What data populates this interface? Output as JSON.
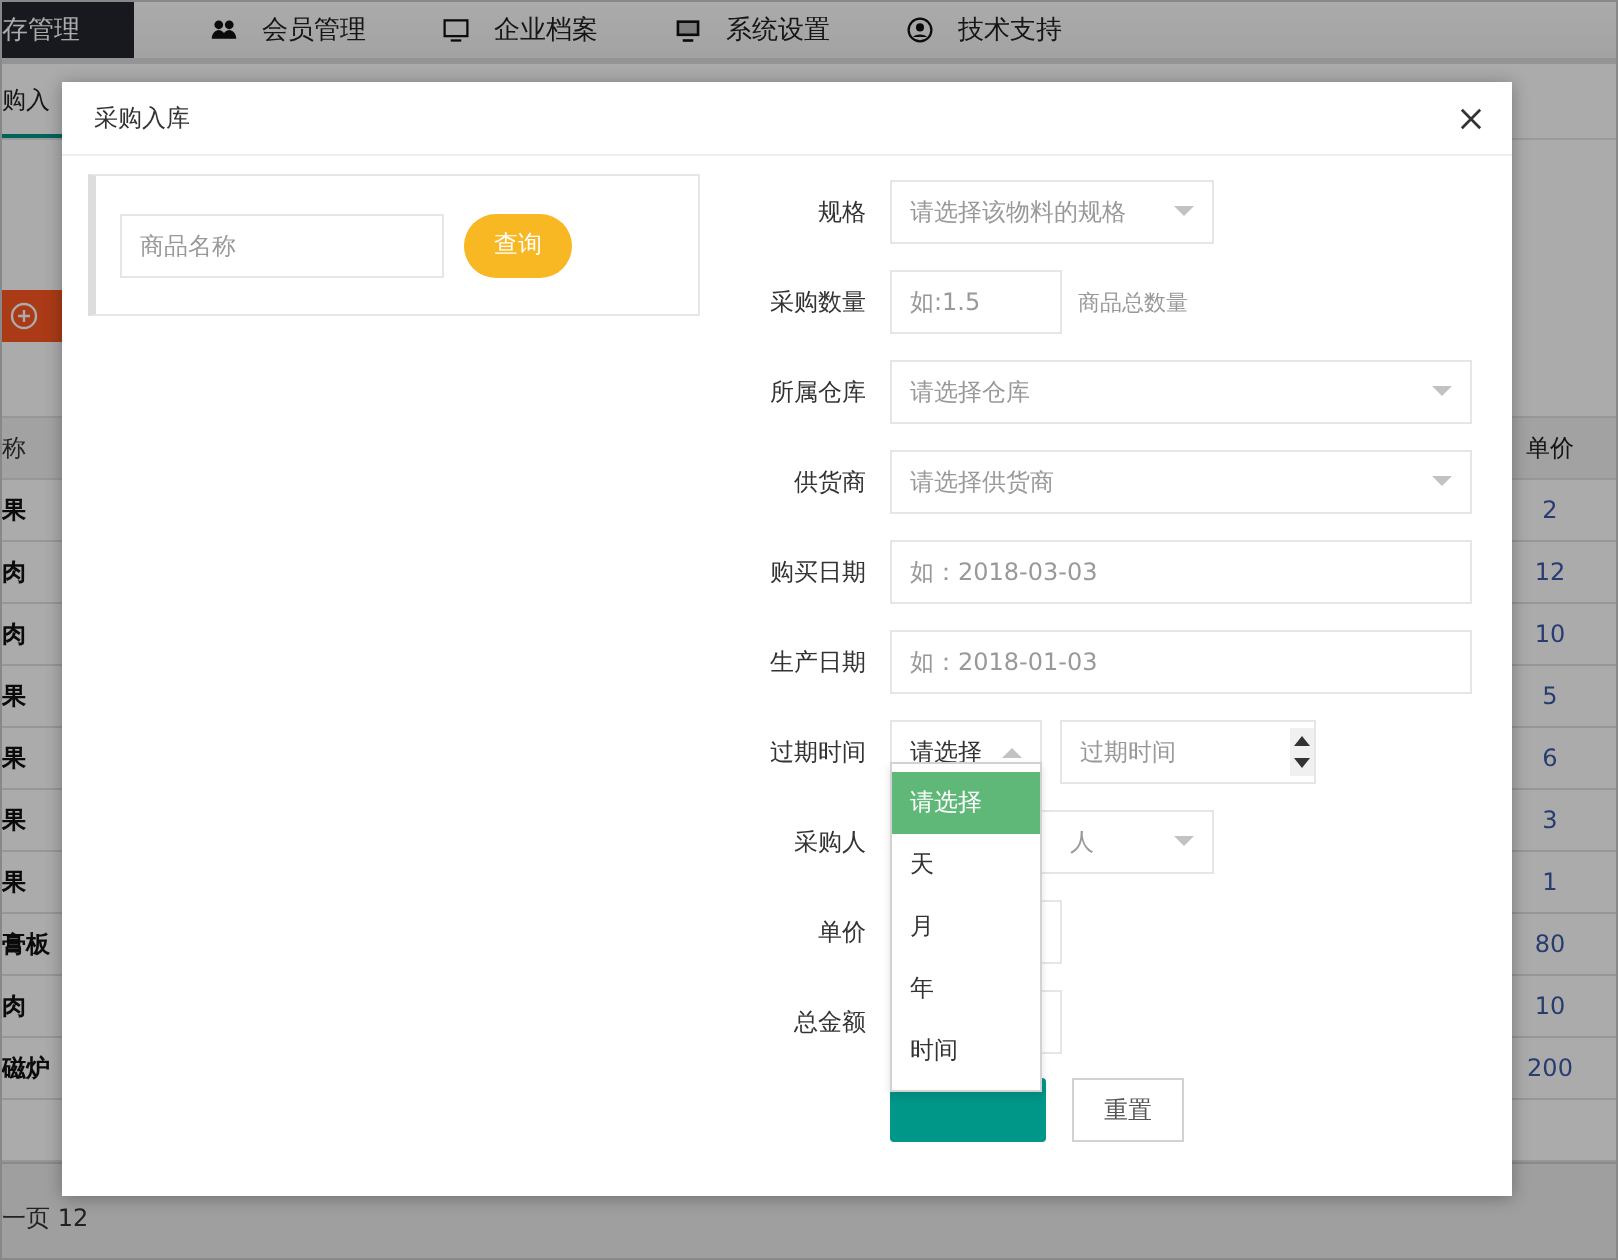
{
  "background": {
    "nav": {
      "items": [
        {
          "label": "存管理",
          "selected": true
        },
        {
          "label": "会员管理",
          "selected": false
        },
        {
          "label": "企业档案",
          "selected": false
        },
        {
          "label": "系统设置",
          "selected": false
        },
        {
          "label": "技术支持",
          "selected": false
        }
      ]
    },
    "tab": "购入",
    "table": {
      "name_column": {
        "header": "称",
        "cells": [
          "果",
          "肉",
          "肉",
          "果",
          "果",
          "果",
          "果",
          "膏板",
          "肉",
          "磁炉"
        ]
      },
      "price_column": {
        "header": "单价",
        "cells": [
          "2",
          "12",
          "10",
          "5",
          "6",
          "3",
          "1",
          "80",
          "10",
          "200"
        ]
      }
    },
    "footer": "一页 12"
  },
  "dialog": {
    "title": "采购入库",
    "search": {
      "placeholder": "商品名称",
      "button": "查询"
    },
    "fields": [
      {
        "kind": "short-select",
        "label": "规格",
        "placeholder": "请选择该物料的规格"
      },
      {
        "kind": "short-text",
        "label": "采购数量",
        "placeholder": "如:1.5",
        "hint": "商品总数量"
      },
      {
        "kind": "select",
        "label": "所属仓库",
        "placeholder": "请选择仓库"
      },
      {
        "kind": "select",
        "label": "供货商",
        "placeholder": "请选择供货商"
      },
      {
        "kind": "text",
        "label": "购买日期",
        "placeholder": "如：2018-03-03"
      },
      {
        "kind": "text",
        "label": "生产日期",
        "placeholder": "如：2018-01-03"
      },
      {
        "kind": "expiry",
        "label": "过期时间",
        "value": "请选择",
        "open": true,
        "spinner_placeholder": "过期时间",
        "options": [
          {
            "label": "请选择",
            "selected": true
          },
          {
            "label": "天",
            "selected": false
          },
          {
            "label": "月",
            "selected": false
          },
          {
            "label": "年",
            "selected": false
          },
          {
            "label": "时间",
            "selected": false
          }
        ]
      },
      {
        "kind": "short-select",
        "label": "采购人",
        "placeholder": "人"
      },
      {
        "kind": "short-text",
        "label": "单价"
      },
      {
        "kind": "short-text",
        "label": "总金额"
      }
    ],
    "buttons": [
      {
        "kind": "submit"
      },
      {
        "kind": "reset",
        "label": "重置"
      }
    ]
  }
}
